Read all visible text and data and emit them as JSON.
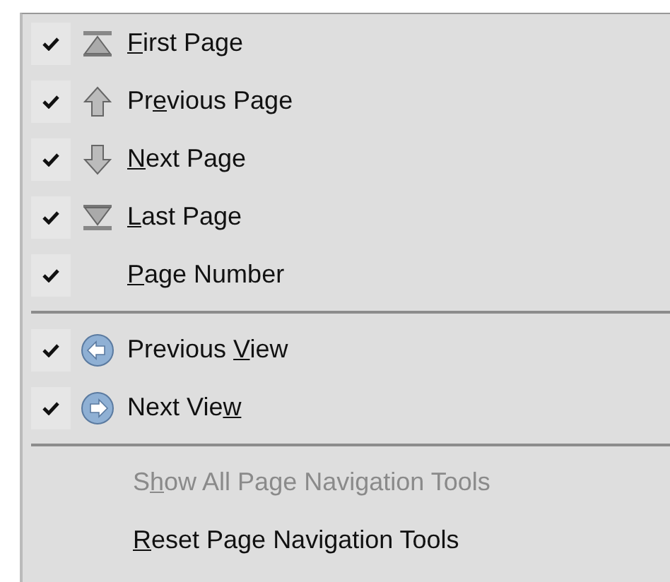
{
  "menu": {
    "sections": [
      {
        "items": [
          {
            "kind": "first",
            "checked": true,
            "label": [
              {
                "text": "F",
                "underlined": true
              },
              {
                "text": "irst Page",
                "underlined": false
              }
            ]
          },
          {
            "kind": "up",
            "checked": true,
            "label": [
              {
                "text": "Pr",
                "underlined": false
              },
              {
                "text": "e",
                "underlined": true
              },
              {
                "text": "vious Page",
                "underlined": false
              }
            ]
          },
          {
            "kind": "down",
            "checked": true,
            "label": [
              {
                "text": "N",
                "underlined": true
              },
              {
                "text": "ext Page",
                "underlined": false
              }
            ]
          },
          {
            "kind": "last",
            "checked": true,
            "label": [
              {
                "text": "L",
                "underlined": true
              },
              {
                "text": "ast Page",
                "underlined": false
              }
            ]
          },
          {
            "kind": "plain",
            "checked": true,
            "label": [
              {
                "text": "P",
                "underlined": true
              },
              {
                "text": "age Number",
                "underlined": false
              }
            ]
          }
        ]
      },
      {
        "items": [
          {
            "kind": "back",
            "checked": true,
            "label": [
              {
                "text": "Previous ",
                "underlined": false
              },
              {
                "text": "V",
                "underlined": true
              },
              {
                "text": "iew",
                "underlined": false
              }
            ]
          },
          {
            "kind": "forward",
            "checked": true,
            "label": [
              {
                "text": "Next Vie",
                "underlined": false
              },
              {
                "text": "w",
                "underlined": true
              }
            ]
          }
        ]
      },
      {
        "items": [
          {
            "kind": "command",
            "disabled": true,
            "label": [
              {
                "text": "S",
                "underlined": false
              },
              {
                "text": "h",
                "underlined": true
              },
              {
                "text": "ow All Page Navigation Tools",
                "underlined": false
              }
            ]
          },
          {
            "kind": "command",
            "disabled": false,
            "label": [
              {
                "text": "R",
                "underlined": true
              },
              {
                "text": "eset Page Navigation Tools",
                "underlined": false
              }
            ]
          }
        ]
      }
    ]
  }
}
